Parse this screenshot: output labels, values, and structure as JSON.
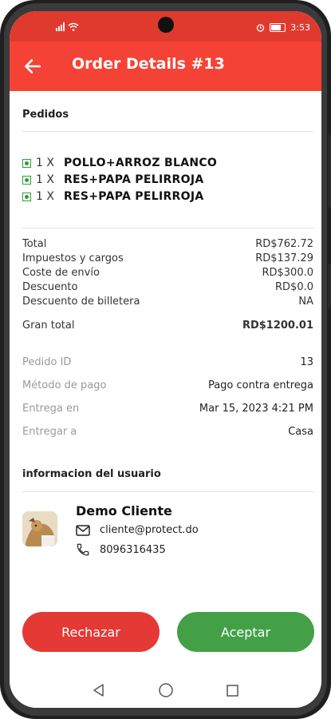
{
  "status_bar": {
    "time": "3:53"
  },
  "app_bar": {
    "title": "Order Details #13"
  },
  "orders": {
    "section_title": "Pedidos",
    "items": [
      {
        "qty": "1 X",
        "name": "POLLO+ARROZ BLANCO"
      },
      {
        "qty": "1 X",
        "name": "RES+PAPA PELIRROJA"
      },
      {
        "qty": "1 X",
        "name": "RES+PAPA PELIRROJA"
      }
    ]
  },
  "summary": {
    "rows": [
      {
        "label": "Total",
        "value": "RD$762.72"
      },
      {
        "label": "Impuestos y cargos",
        "value": "RD$137.29"
      },
      {
        "label": "Coste de envío",
        "value": "RD$300.0"
      },
      {
        "label": "Descuento",
        "value": "RD$0.0"
      },
      {
        "label": "Descuento de billetera",
        "value": "NA"
      }
    ],
    "grand_total_label": "Gran total",
    "grand_total_value": "RD$1200.01"
  },
  "meta": {
    "rows": [
      {
        "label": "Pedido ID",
        "value": "13"
      },
      {
        "label": "Método de pago",
        "value": "Pago contra entrega"
      },
      {
        "label": "Entrega en",
        "value": "Mar 15, 2023 4:21 PM"
      },
      {
        "label": "Entregar a",
        "value": "Casa"
      }
    ]
  },
  "user": {
    "section_title": "informacion del usuario",
    "name": "Demo Cliente",
    "email": "cliente@protect.do",
    "phone": "8096316435"
  },
  "actions": {
    "reject": "Rechazar",
    "accept": "Aceptar"
  },
  "colors": {
    "primary": "#f44336",
    "reject": "#e53935",
    "accept": "#43a047"
  }
}
